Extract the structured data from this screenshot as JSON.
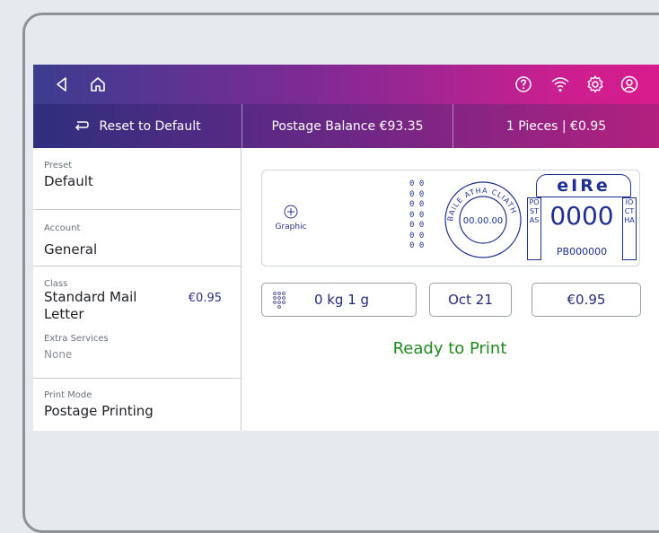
{
  "topbar": {
    "icons": [
      "back-icon",
      "home-icon",
      "help-icon",
      "wifi-icon",
      "settings-icon",
      "account-icon"
    ]
  },
  "subbar": {
    "reset_label": "Reset to Default",
    "balance_label": "Postage Balance €93.35",
    "pieces_label": "1 Pieces | €0.95"
  },
  "left": {
    "preset": {
      "label": "Preset",
      "value": "Default"
    },
    "account": {
      "label": "Account",
      "value": "General"
    },
    "class": {
      "label": "Class",
      "value_line1": "Standard Mail",
      "value_line2": "Letter",
      "price": "€0.95"
    },
    "extra": {
      "label": "Extra Services",
      "value": "None"
    },
    "print_mode": {
      "label": "Print Mode",
      "value": "Postage Printing"
    }
  },
  "indicia": {
    "graphic_label": "Graphic",
    "zeros": [
      "0 0",
      "0 0",
      "0 0",
      "0 0",
      "0 0",
      "0 0",
      "0 0"
    ],
    "stamp_ring_text": "BAILE ATHA CLIATH",
    "stamp_date": "00.00.00",
    "eire_text": "eIRe",
    "amount": "0000",
    "meter_id": "PB000000",
    "postas": "POSTAS",
    "ioctha": "IOCTHA"
  },
  "fields": {
    "weight": "0 kg 1 g",
    "date": "Oct 21",
    "amount": "€0.95"
  },
  "status": "Ready to Print",
  "colors": {
    "accent": "#2d2f87",
    "ready": "#1f8a1f",
    "stamp": "#1f2f8f"
  }
}
